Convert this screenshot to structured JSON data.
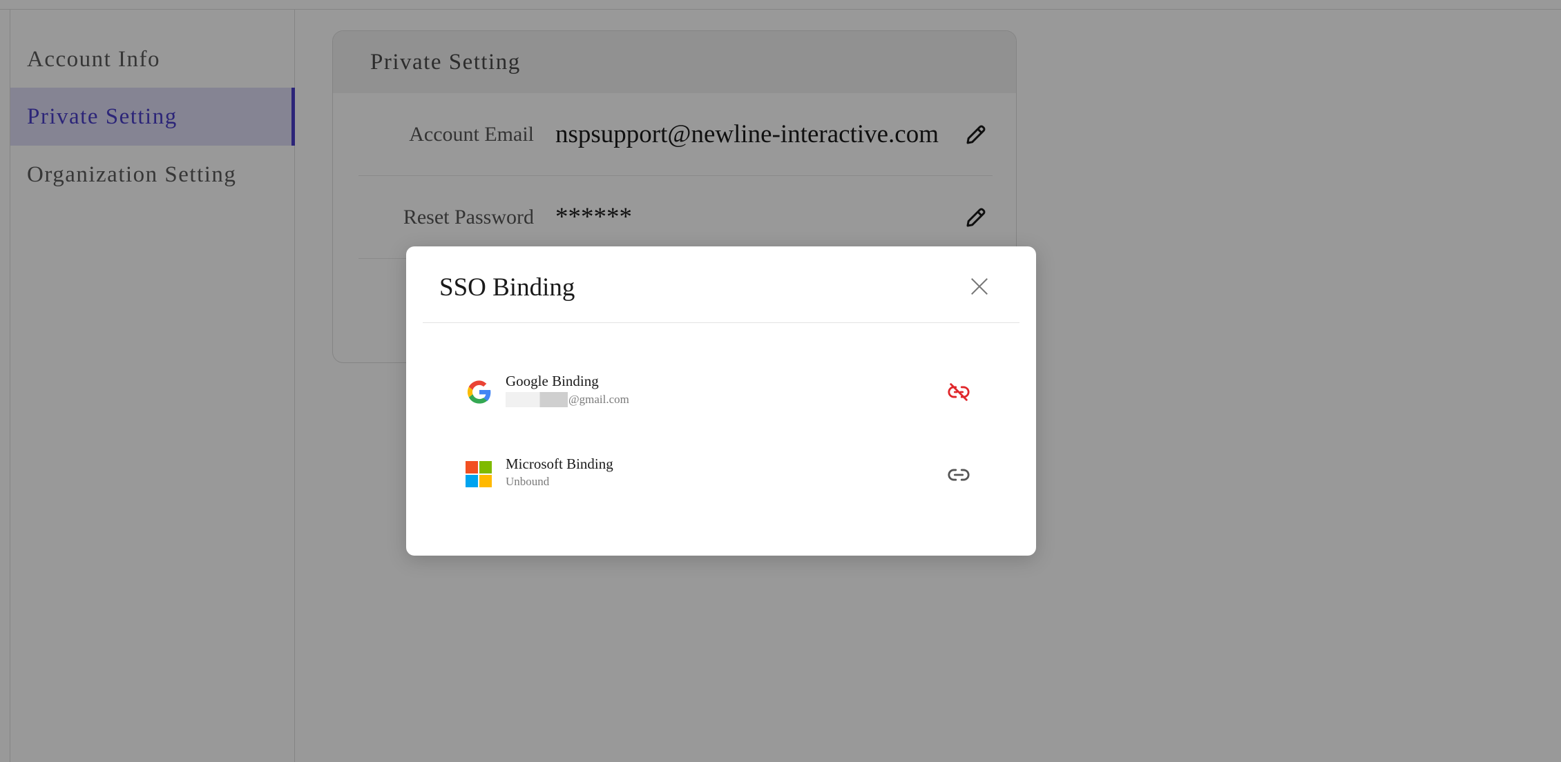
{
  "sidebar": {
    "items": [
      {
        "label": "Account Info",
        "active": false
      },
      {
        "label": "Private Setting",
        "active": true
      },
      {
        "label": "Organization Setting",
        "active": false
      }
    ]
  },
  "card": {
    "title": "Private Setting",
    "rows": [
      {
        "label": "Account Email",
        "value": "nspsupport@newline-interactive.com",
        "icon": "pencil-icon"
      },
      {
        "label": "Reset Password",
        "value": "******",
        "icon": "pencil-icon"
      }
    ]
  },
  "modal": {
    "title": "SSO Binding",
    "close_icon": "close-icon",
    "bindings": [
      {
        "name": "Google Binding",
        "status": "@gmail.com",
        "redacted": true,
        "action_icon": "unlink-icon",
        "action_color": "#e0262a"
      },
      {
        "name": "Microsoft Binding",
        "status": "Unbound",
        "redacted": false,
        "action_icon": "link-icon",
        "action_color": "#555555"
      }
    ]
  },
  "colors": {
    "accent": "#4a3fc9",
    "active_bg": "#dedcf6",
    "overlay": "rgba(0,0,0,0.40)"
  }
}
